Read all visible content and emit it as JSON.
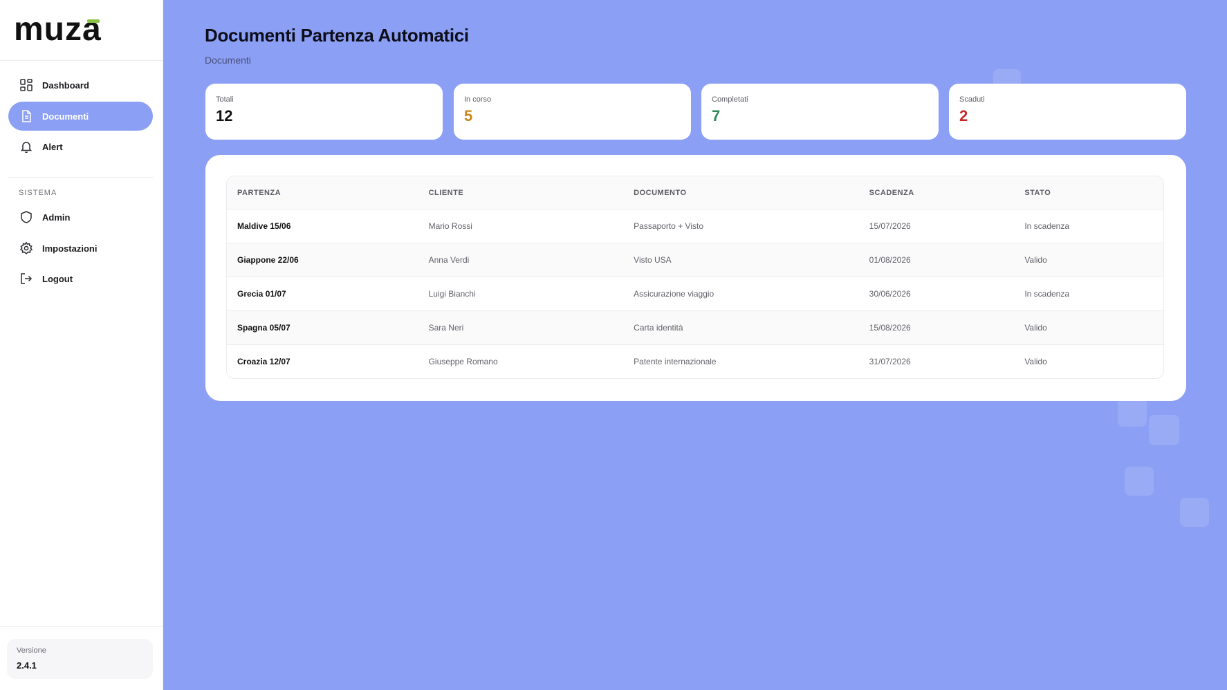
{
  "app": {
    "logo_text": "muza",
    "brand_colors": {
      "primary": "#8b9ff5",
      "accent_green": "#8bc34a",
      "accent_purple": "#6b3fe0"
    }
  },
  "sidebar": {
    "items": [
      {
        "label": "Dashboard",
        "icon": "dashboard-grid-icon",
        "active": false
      },
      {
        "label": "Documenti",
        "icon": "document-icon",
        "active": true
      },
      {
        "label": "Alert",
        "icon": "bell-icon",
        "active": false
      }
    ],
    "section_label": "SISTEMA",
    "system_items": [
      {
        "label": "Admin",
        "icon": "shield-icon"
      },
      {
        "label": "Impostazioni",
        "icon": "gear-icon"
      },
      {
        "label": "Logout",
        "icon": "logout-icon"
      }
    ],
    "version": {
      "label": "Versione",
      "value": "2.4.1"
    }
  },
  "header": {
    "title": "Documenti Partenza Automatici",
    "breadcrumb": "Documenti"
  },
  "stats": [
    {
      "label": "Totali",
      "value": "12",
      "color": "#111111"
    },
    {
      "label": "In corso",
      "value": "5",
      "color": "#c9861a"
    },
    {
      "label": "Completati",
      "value": "7",
      "color": "#2e8b57"
    },
    {
      "label": "Scaduti",
      "value": "2",
      "color": "#c62828"
    }
  ],
  "table": {
    "columns": [
      "PARTENZA",
      "CLIENTE",
      "DOCUMENTO",
      "SCADENZA",
      "STATO"
    ],
    "rows": [
      [
        "Maldive 15/06",
        "Mario Rossi",
        "Passaporto + Visto",
        "15/07/2026",
        "In scadenza"
      ],
      [
        "Giappone 22/06",
        "Anna Verdi",
        "Visto USA",
        "01/08/2026",
        "Valido"
      ],
      [
        "Grecia 01/07",
        "Luigi Bianchi",
        "Assicurazione viaggio",
        "30/06/2026",
        "In scadenza"
      ],
      [
        "Spagna 05/07",
        "Sara Neri",
        "Carta identità",
        "15/08/2026",
        "Valido"
      ],
      [
        "Croazia 12/07",
        "Giuseppe Romano",
        "Patente internazionale",
        "31/07/2026",
        "Valido"
      ]
    ]
  }
}
